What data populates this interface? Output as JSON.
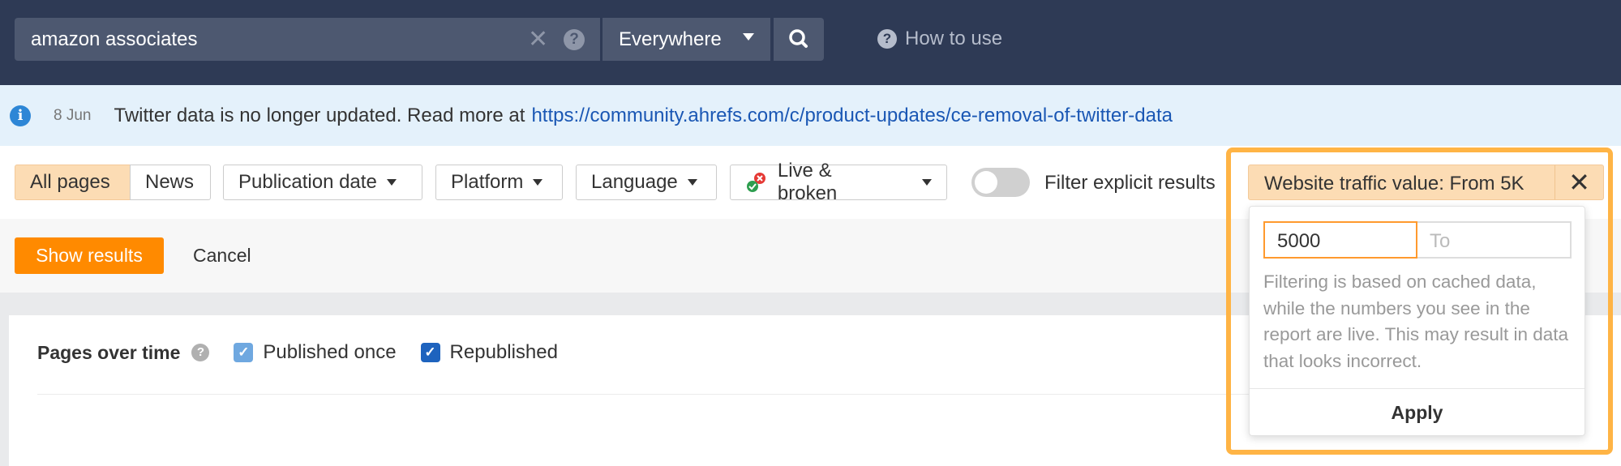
{
  "header": {
    "search_value": "amazon associates",
    "scope": "Everywhere",
    "how_to_use": "How to use"
  },
  "banner": {
    "date": "8 Jun",
    "text": "Twitter data is no longer updated. Read more at",
    "link": "https://community.ahrefs.com/c/product-updates/ce-removal-of-twitter-data"
  },
  "filters": {
    "all_pages": "All pages",
    "news": "News",
    "publication_date": "Publication date",
    "platform": "Platform",
    "language": "Language",
    "live_broken": "Live & broken",
    "filter_explicit": "Filter explicit results",
    "traffic_chip": "Website traffic value: From 5K"
  },
  "actions": {
    "show_results": "Show results",
    "cancel": "Cancel"
  },
  "chart": {
    "title": "Pages over time",
    "published_once": "Published once",
    "republished": "Republished"
  },
  "popup": {
    "from_value": "5000",
    "to_placeholder": "To",
    "note": "Filtering is based on cached data, while the numbers you see in the report are live. This may result in data that looks incorrect.",
    "apply": "Apply"
  }
}
